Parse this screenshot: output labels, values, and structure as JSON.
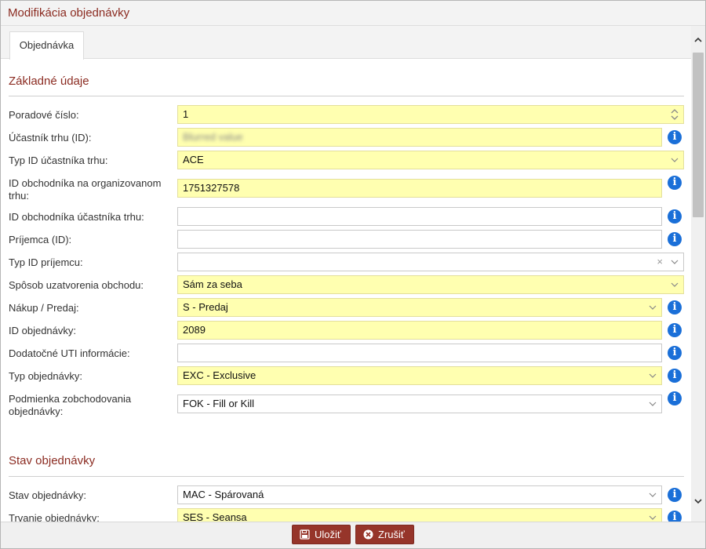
{
  "window": {
    "title": "Modifikácia objednávky"
  },
  "tabs": [
    {
      "label": "Objednávka"
    }
  ],
  "sections": {
    "basic": "Základné údaje",
    "status": "Stav objednávky"
  },
  "fields": {
    "poradove": {
      "label": "Poradové číslo:",
      "value": "1"
    },
    "ucastnik": {
      "label": "Účastník trhu (ID):",
      "value": "Blurred value"
    },
    "typ_id_ucastnika": {
      "label": "Typ ID účastníka trhu:",
      "value": "ACE"
    },
    "id_obchodnika_org": {
      "label": "ID obchodníka na organizovanom trhu:",
      "value": "1751327578"
    },
    "id_obchodnika_ucastnika": {
      "label": "ID obchodníka účastníka trhu:",
      "value": ""
    },
    "prijemca": {
      "label": "Príjemca (ID):",
      "value": ""
    },
    "typ_id_prijemcu": {
      "label": "Typ ID príjemcu:",
      "value": "",
      "clear": "×"
    },
    "sposob": {
      "label": "Spôsob uzatvorenia obchodu:",
      "value": "Sám za seba"
    },
    "nakup_predaj": {
      "label": "Nákup / Predaj:",
      "value": "S - Predaj"
    },
    "id_objednavky": {
      "label": "ID objednávky:",
      "value": "2089"
    },
    "uti": {
      "label": "Dodatočné UTI informácie:",
      "value": ""
    },
    "typ_objednavky": {
      "label": "Typ objednávky:",
      "value": "EXC - Exclusive"
    },
    "podmienka": {
      "label": "Podmienka zobchodovania objednávky:",
      "value": "FOK - Fill or Kill"
    },
    "stav": {
      "label": "Stav objednávky:",
      "value": "MAC - Spárovaná"
    },
    "trvanie": {
      "label": "Trvanie objednávky:",
      "value": "SES - Seansa"
    }
  },
  "info_glyph": "i",
  "buttons": {
    "save": "Uložiť",
    "cancel": "Zrušiť"
  },
  "icons": {
    "info": "info-circle-icon",
    "save": "floppy-disk-icon",
    "cancel": "x-circle-icon"
  },
  "colors": {
    "accent": "#96352a",
    "title": "#8b2b21",
    "required_bg": "#ffffb0",
    "info": "#1a6fd8"
  }
}
